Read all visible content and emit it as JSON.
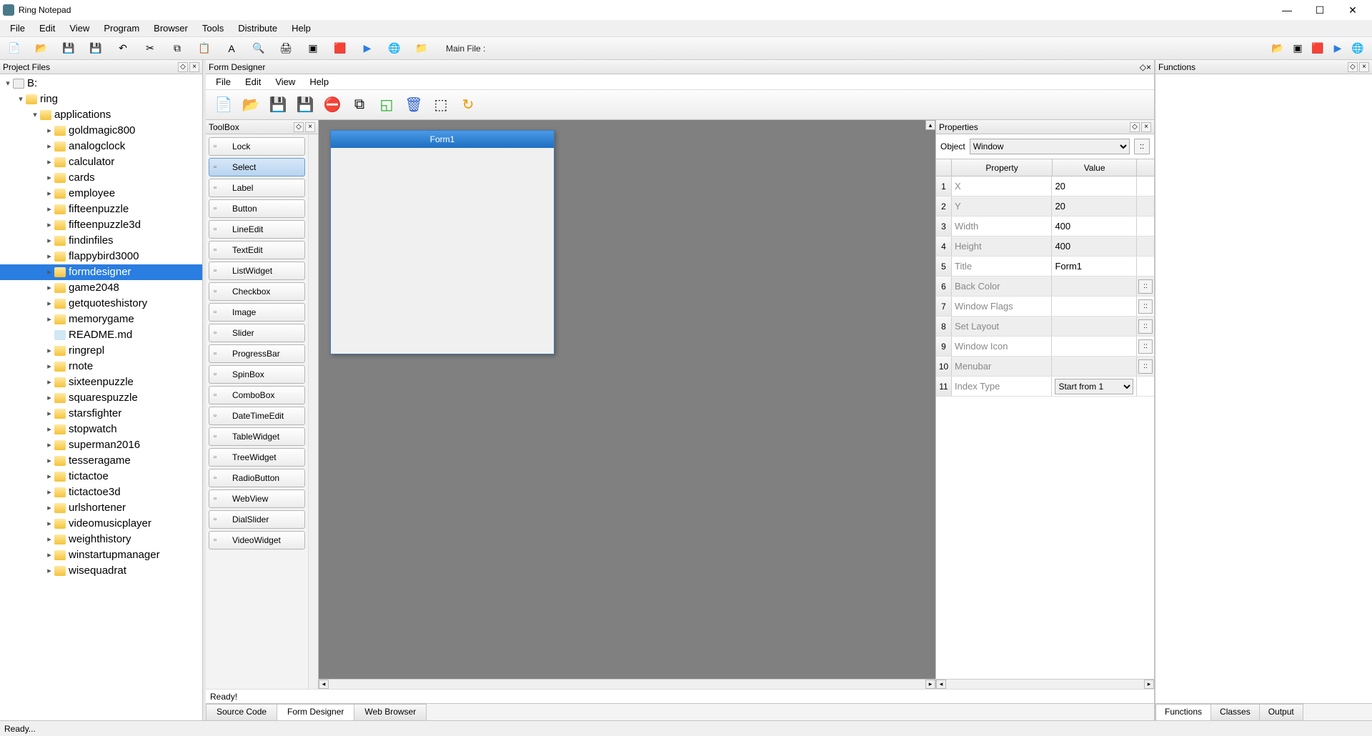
{
  "window": {
    "title": "Ring Notepad"
  },
  "menubar": [
    "File",
    "Edit",
    "View",
    "Program",
    "Browser",
    "Tools",
    "Distribute",
    "Help"
  ],
  "toolbar_label": "Main File :",
  "project_files": {
    "title": "Project Files",
    "tree": [
      {
        "depth": 0,
        "type": "drive",
        "label": "B:",
        "exp": "▾"
      },
      {
        "depth": 1,
        "type": "folder",
        "label": "ring",
        "exp": "▾"
      },
      {
        "depth": 2,
        "type": "folder",
        "label": "applications",
        "exp": "▾"
      },
      {
        "depth": 3,
        "type": "folder",
        "label": "goldmagic800",
        "exp": "▸"
      },
      {
        "depth": 3,
        "type": "folder",
        "label": "analogclock",
        "exp": "▸"
      },
      {
        "depth": 3,
        "type": "folder",
        "label": "calculator",
        "exp": "▸"
      },
      {
        "depth": 3,
        "type": "folder",
        "label": "cards",
        "exp": "▸"
      },
      {
        "depth": 3,
        "type": "folder",
        "label": "employee",
        "exp": "▸"
      },
      {
        "depth": 3,
        "type": "folder",
        "label": "fifteenpuzzle",
        "exp": "▸"
      },
      {
        "depth": 3,
        "type": "folder",
        "label": "fifteenpuzzle3d",
        "exp": "▸"
      },
      {
        "depth": 3,
        "type": "folder",
        "label": "findinfiles",
        "exp": "▸"
      },
      {
        "depth": 3,
        "type": "folder",
        "label": "flappybird3000",
        "exp": "▸"
      },
      {
        "depth": 3,
        "type": "folder",
        "label": "formdesigner",
        "exp": "▸",
        "selected": true
      },
      {
        "depth": 3,
        "type": "folder",
        "label": "game2048",
        "exp": "▸"
      },
      {
        "depth": 3,
        "type": "folder",
        "label": "getquoteshistory",
        "exp": "▸"
      },
      {
        "depth": 3,
        "type": "folder",
        "label": "memorygame",
        "exp": "▸"
      },
      {
        "depth": 3,
        "type": "file",
        "label": "README.md",
        "exp": ""
      },
      {
        "depth": 3,
        "type": "folder",
        "label": "ringrepl",
        "exp": "▸"
      },
      {
        "depth": 3,
        "type": "folder",
        "label": "rnote",
        "exp": "▸"
      },
      {
        "depth": 3,
        "type": "folder",
        "label": "sixteenpuzzle",
        "exp": "▸"
      },
      {
        "depth": 3,
        "type": "folder",
        "label": "squarespuzzle",
        "exp": "▸"
      },
      {
        "depth": 3,
        "type": "folder",
        "label": "starsfighter",
        "exp": "▸"
      },
      {
        "depth": 3,
        "type": "folder",
        "label": "stopwatch",
        "exp": "▸"
      },
      {
        "depth": 3,
        "type": "folder",
        "label": "superman2016",
        "exp": "▸"
      },
      {
        "depth": 3,
        "type": "folder",
        "label": "tesseragame",
        "exp": "▸"
      },
      {
        "depth": 3,
        "type": "folder",
        "label": "tictactoe",
        "exp": "▸"
      },
      {
        "depth": 3,
        "type": "folder",
        "label": "tictactoe3d",
        "exp": "▸"
      },
      {
        "depth": 3,
        "type": "folder",
        "label": "urlshortener",
        "exp": "▸"
      },
      {
        "depth": 3,
        "type": "folder",
        "label": "videomusicplayer",
        "exp": "▸"
      },
      {
        "depth": 3,
        "type": "folder",
        "label": "weighthistory",
        "exp": "▸"
      },
      {
        "depth": 3,
        "type": "folder",
        "label": "winstartupmanager",
        "exp": "▸"
      },
      {
        "depth": 3,
        "type": "folder",
        "label": "wisequadrat",
        "exp": "▸"
      }
    ]
  },
  "form_designer": {
    "panel_title": "Form Designer",
    "menubar": [
      "File",
      "Edit",
      "View",
      "Help"
    ],
    "toolbox_title": "ToolBox",
    "toolbox": [
      {
        "label": "Lock"
      },
      {
        "label": "Select",
        "selected": true
      },
      {
        "label": "Label"
      },
      {
        "label": "Button"
      },
      {
        "label": "LineEdit"
      },
      {
        "label": "TextEdit"
      },
      {
        "label": "ListWidget"
      },
      {
        "label": "Checkbox"
      },
      {
        "label": "Image"
      },
      {
        "label": "Slider"
      },
      {
        "label": "ProgressBar"
      },
      {
        "label": "SpinBox"
      },
      {
        "label": "ComboBox"
      },
      {
        "label": "DateTimeEdit"
      },
      {
        "label": "TableWidget"
      },
      {
        "label": "TreeWidget"
      },
      {
        "label": "RadioButton"
      },
      {
        "label": "WebView"
      },
      {
        "label": "DialSlider"
      },
      {
        "label": "VideoWidget"
      }
    ],
    "form_title": "Form1",
    "properties_title": "Properties",
    "object_label": "Object",
    "object_value": "Window",
    "prop_header": {
      "c1": "Property",
      "c2": "Value"
    },
    "props": [
      {
        "n": "1",
        "name": "X",
        "value": "20",
        "more": false
      },
      {
        "n": "2",
        "name": "Y",
        "value": "20",
        "more": false
      },
      {
        "n": "3",
        "name": "Width",
        "value": "400",
        "more": false
      },
      {
        "n": "4",
        "name": "Height",
        "value": "400",
        "more": false
      },
      {
        "n": "5",
        "name": "Title",
        "value": "Form1",
        "more": false
      },
      {
        "n": "6",
        "name": "Back Color",
        "value": "",
        "more": true
      },
      {
        "n": "7",
        "name": "Window Flags",
        "value": "",
        "more": true
      },
      {
        "n": "8",
        "name": "Set Layout",
        "value": "",
        "more": true
      },
      {
        "n": "9",
        "name": "Window Icon",
        "value": "",
        "more": true
      },
      {
        "n": "10",
        "name": "Menubar",
        "value": "",
        "more": true
      },
      {
        "n": "11",
        "name": "Index Type",
        "value": "Start from 1",
        "more": false,
        "select": true
      }
    ],
    "status": "Ready!",
    "bottom_tabs": [
      "Source Code",
      "Form Designer",
      "Web Browser"
    ],
    "active_tab": 1
  },
  "functions": {
    "title": "Functions",
    "tabs": [
      "Functions",
      "Classes",
      "Output"
    ],
    "active": 0
  },
  "statusbar": "Ready..."
}
